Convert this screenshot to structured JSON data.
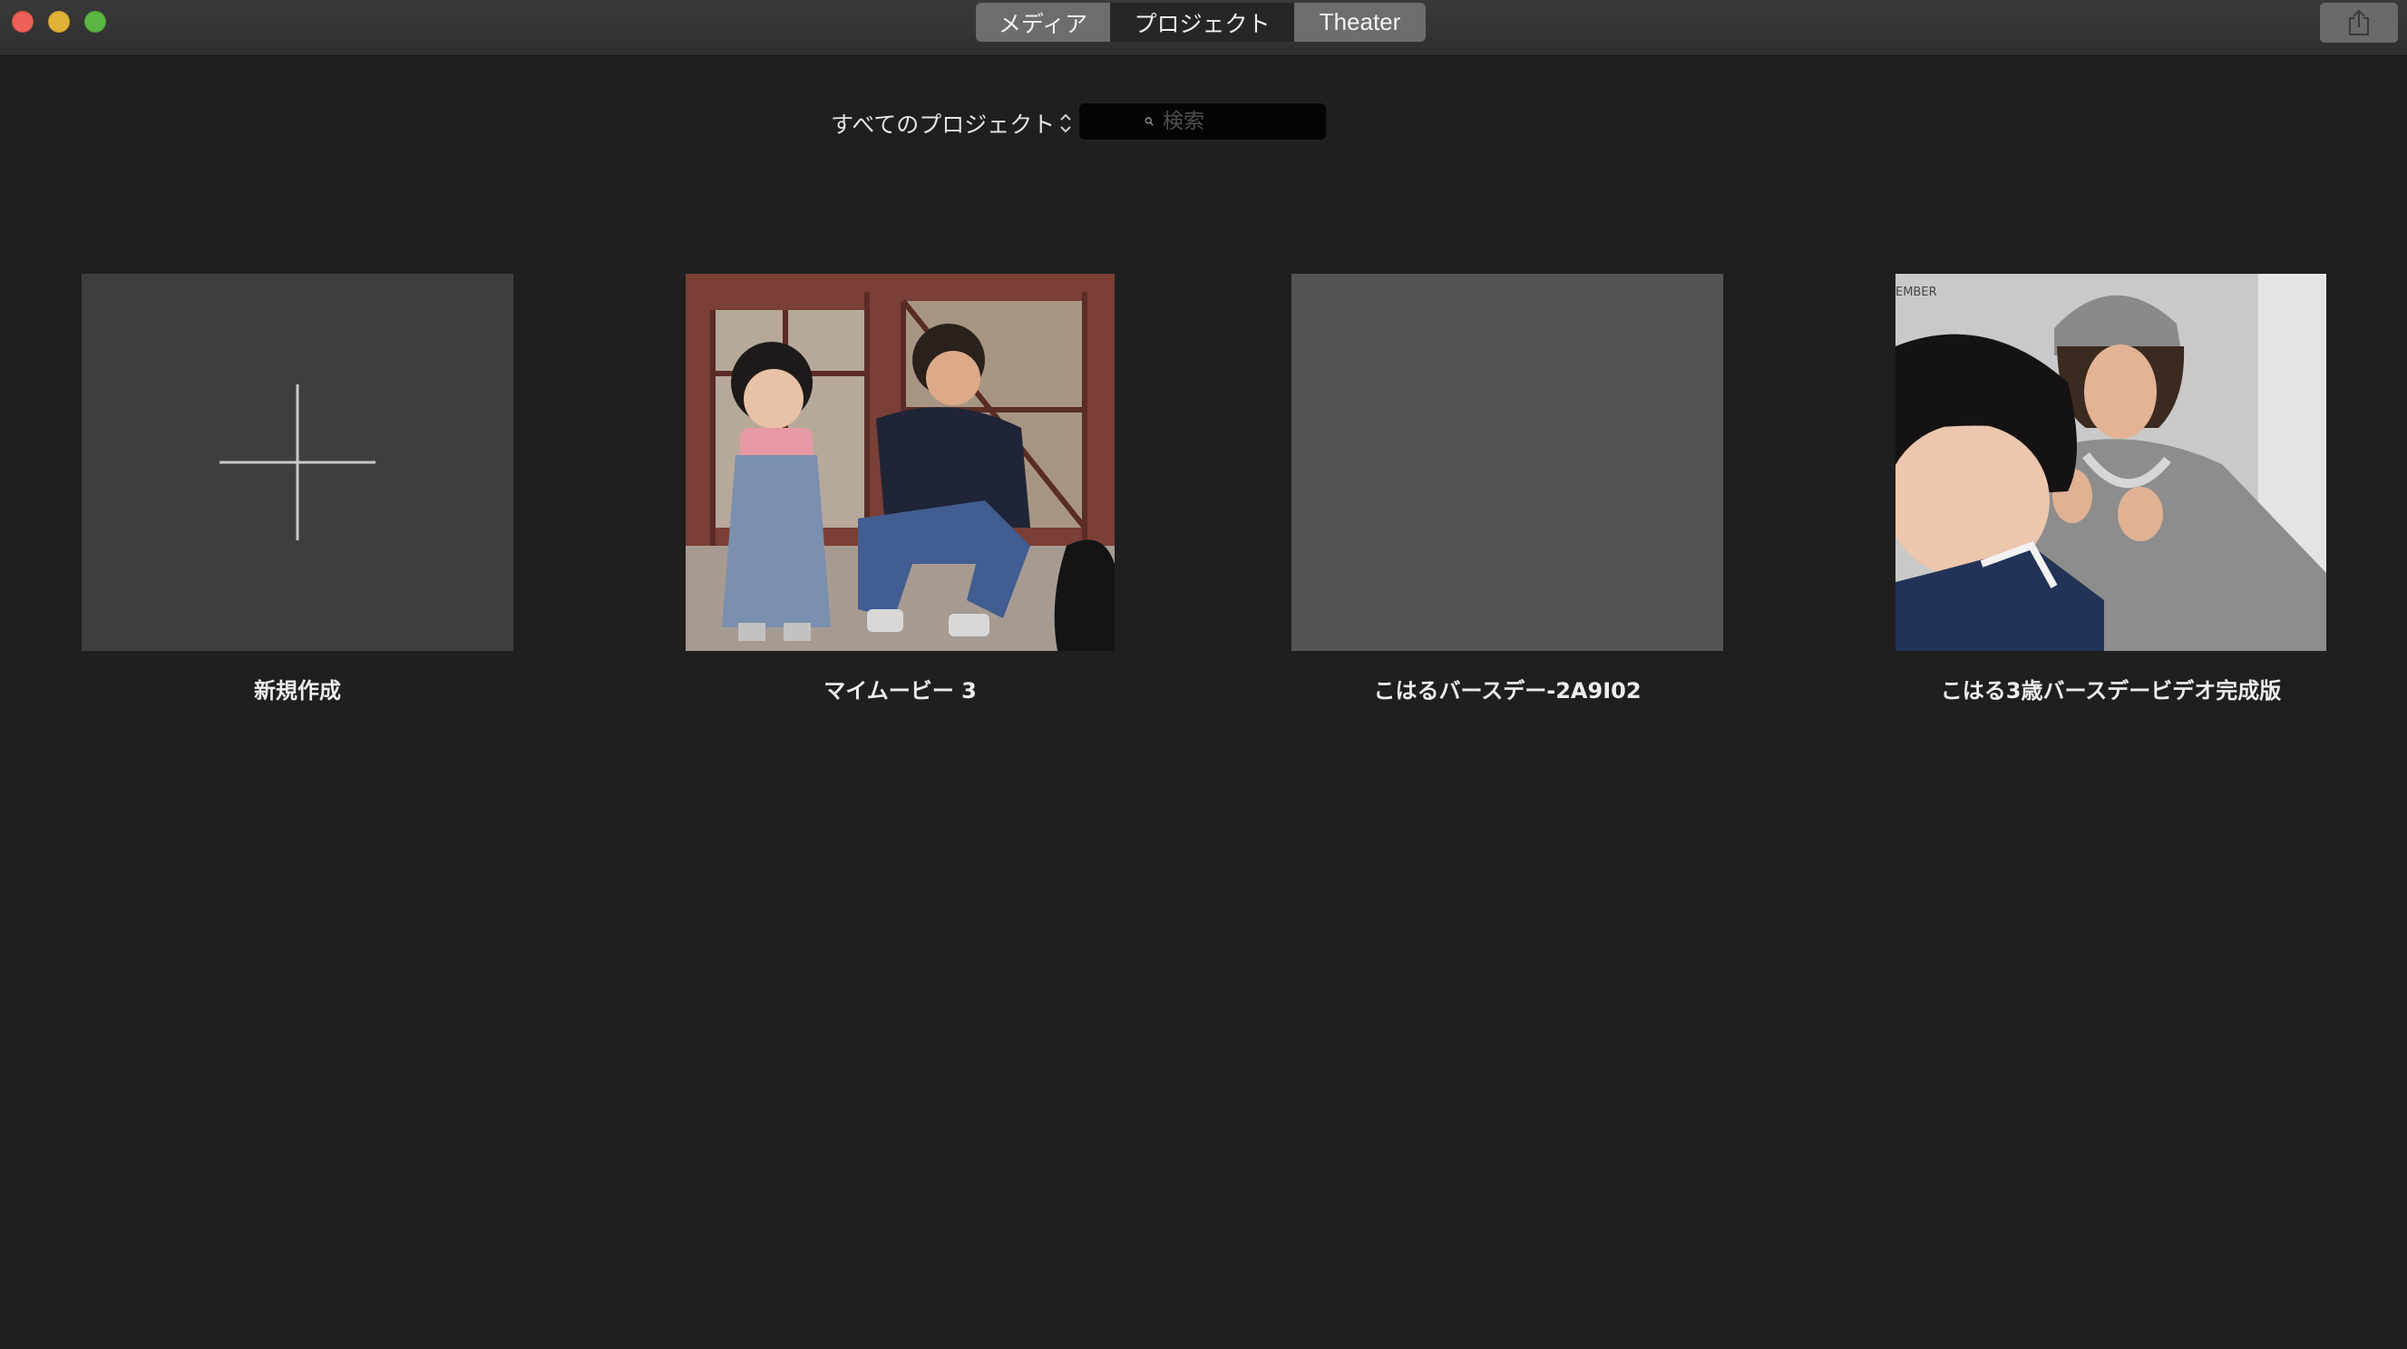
{
  "tabs": {
    "media": "メディア",
    "project": "プロジェクト",
    "theater": "Theater",
    "selected": "project"
  },
  "toolbar": {
    "filter_label": "すべてのプロジェクト",
    "search_placeholder": "検索"
  },
  "projects": [
    {
      "label": "新規作成",
      "kind": "new",
      "icon": "plus-icon"
    },
    {
      "label": "マイムービー 3",
      "kind": "thumbnail"
    },
    {
      "label": "こはるバースデー-2A9I02",
      "kind": "empty"
    },
    {
      "label": "こはる3歳バースデービデオ完成版",
      "kind": "thumbnail"
    }
  ],
  "thumbnail_text": {
    "p3_corner": "EMBER"
  },
  "icons": {
    "share": "share-icon",
    "search": "search-icon",
    "filter_arrows": "up-down-chevron-icon"
  },
  "colors": {
    "window_bg": "#1f1f1f",
    "titlebar": "#333333",
    "segment": "#6d6d6d",
    "segment_selected": "#262626",
    "tile_new": "#3e3e3e",
    "tile_empty": "#545454",
    "close": "#ed5f57",
    "minimize": "#e0b338",
    "zoom": "#5bb643"
  }
}
